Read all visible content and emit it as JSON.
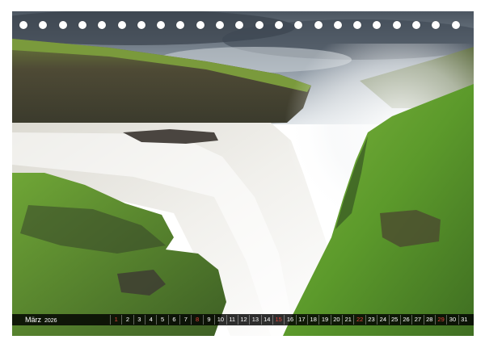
{
  "calendar": {
    "month": "März",
    "year": "2026",
    "days": [
      "1",
      "2",
      "3",
      "4",
      "5",
      "6",
      "7",
      "8",
      "9",
      "10",
      "11",
      "12",
      "13",
      "14",
      "15",
      "16",
      "17",
      "18",
      "19",
      "20",
      "21",
      "22",
      "23",
      "24",
      "25",
      "26",
      "27",
      "28",
      "29",
      "30",
      "31"
    ],
    "sundays": [
      1,
      8,
      15,
      22,
      29
    ]
  },
  "colors": {
    "sunday": "#e0453c",
    "bar": "#111111",
    "grass": "#5f9e2c"
  }
}
